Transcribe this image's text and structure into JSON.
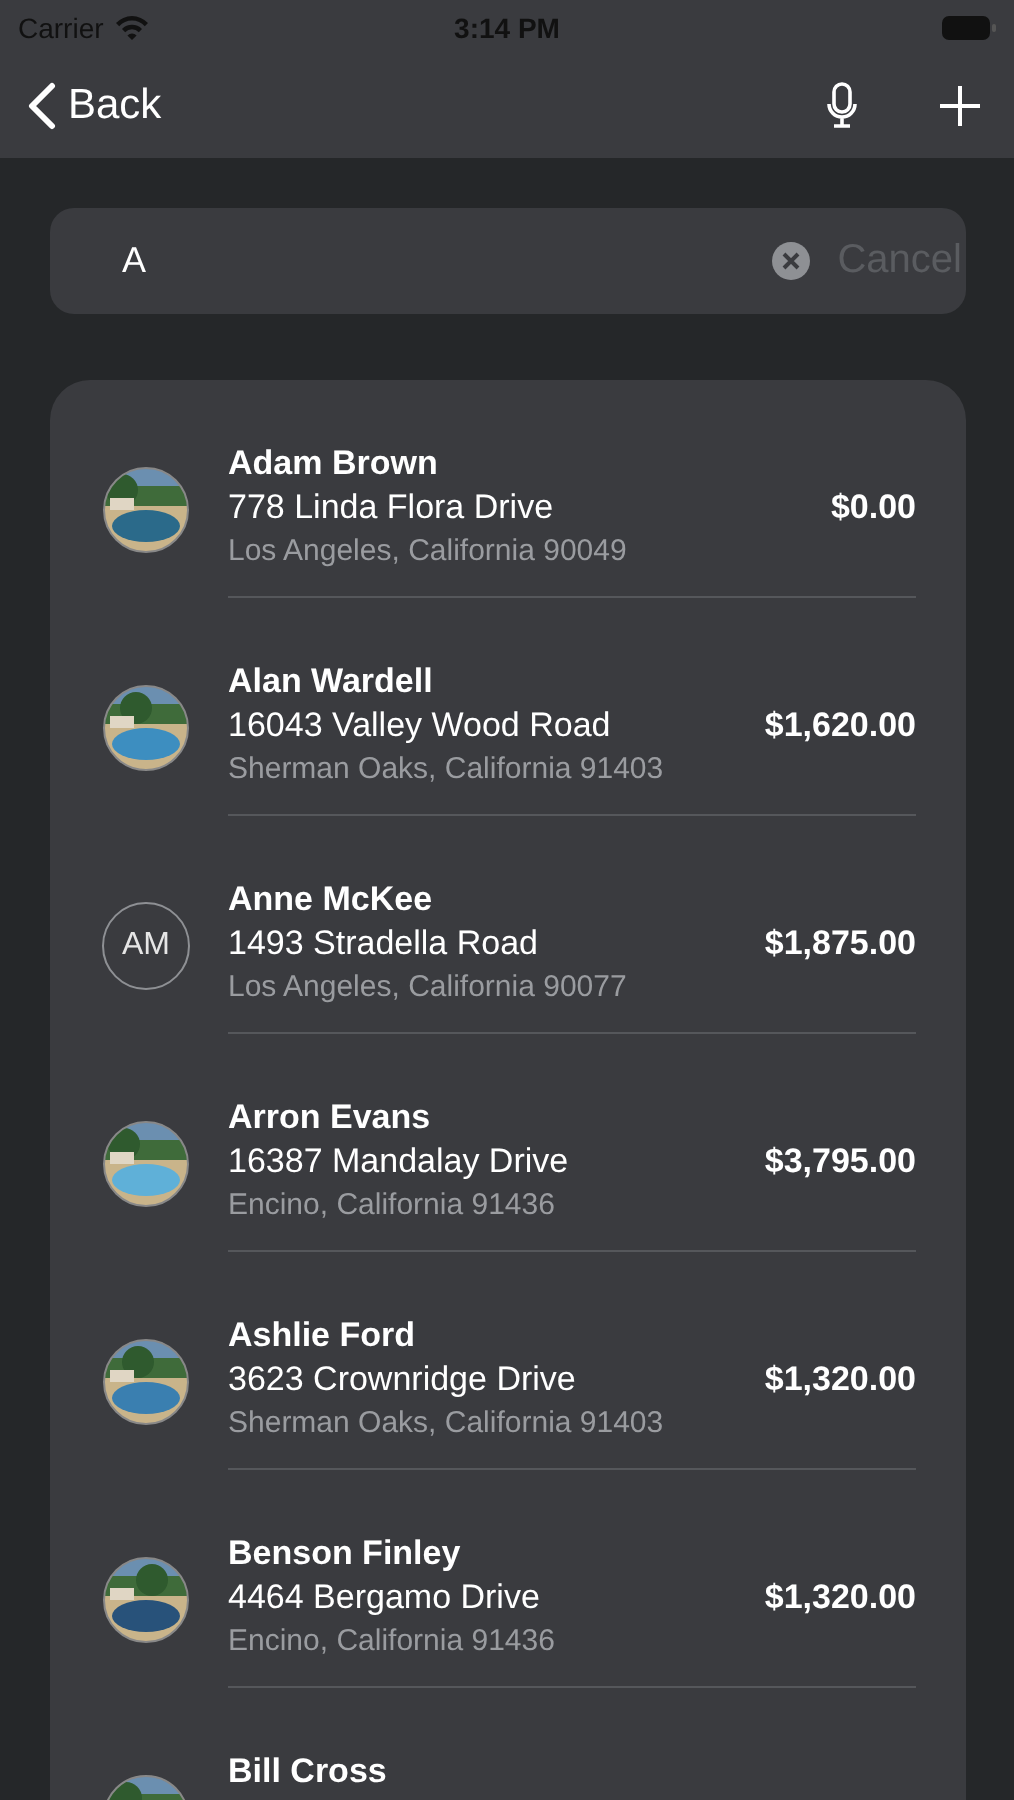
{
  "status_bar": {
    "carrier": "Carrier",
    "time": "3:14 PM"
  },
  "nav": {
    "back": "Back"
  },
  "search": {
    "value": "A",
    "cancel": "Cancel"
  },
  "customers": [
    {
      "name": "Adam Brown",
      "street": "778 Linda Flora Drive",
      "city": "Los Angeles, California 90049",
      "amount": "$0.00"
    },
    {
      "name": "Alan Wardell",
      "street": "16043 Valley Wood Road",
      "city": "Sherman Oaks, California 91403",
      "amount": "$1,620.00"
    },
    {
      "avatar": {
        "kind": "initials",
        "text": "AM"
      },
      "name": "Anne McKee",
      "street": "1493 Stradella Road",
      "city": "Los Angeles, California 90077",
      "amount": "$1,875.00"
    },
    {
      "name": "Arron Evans",
      "street": "16387 Mandalay Drive",
      "city": "Encino, California 91436",
      "amount": "$3,795.00"
    },
    {
      "name": "Ashlie Ford",
      "street": "3623 Crownridge Drive",
      "city": "Sherman Oaks, California 91403",
      "amount": "$1,320.00"
    },
    {
      "name": "Benson Finley",
      "street": "4464 Bergamo Drive",
      "city": "Encino, California 91436",
      "amount": "$1,320.00"
    },
    {
      "name": "Bill Cross"
    }
  ]
}
